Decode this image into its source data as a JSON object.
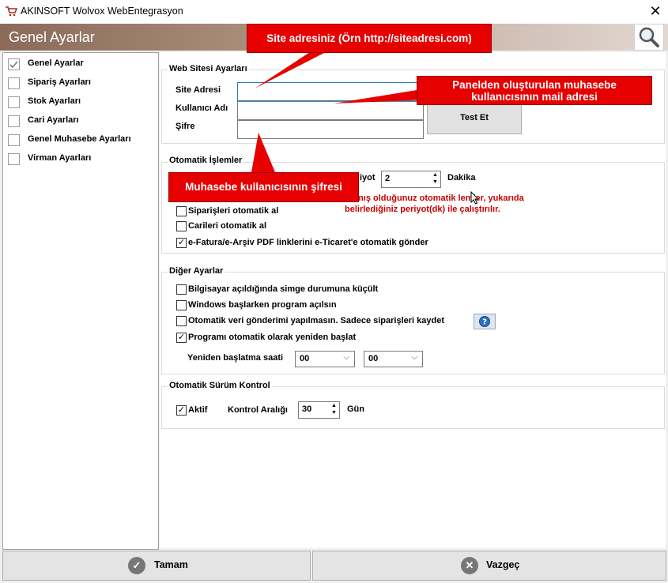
{
  "window": {
    "title": "AKINSOFT Wolvox WebEntegrasyon",
    "close_glyph": "✕"
  },
  "header": {
    "title": "Genel Ayarlar"
  },
  "sidebar": {
    "items": [
      {
        "label": "Genel Ayarlar",
        "checked": true
      },
      {
        "label": "Sipariş Ayarları",
        "checked": false
      },
      {
        "label": "Stok Ayarları",
        "checked": false
      },
      {
        "label": "Cari Ayarları",
        "checked": false
      },
      {
        "label": "Genel Muhasebe Ayarları",
        "checked": false
      },
      {
        "label": "Virman Ayarları",
        "checked": false
      }
    ]
  },
  "website": {
    "group_label": "Web Sitesi Ayarları",
    "site_label": "Site Adresi",
    "site_value": "",
    "user_label": "Kullanıcı Adı",
    "user_value": "",
    "pass_label": "Şifre",
    "pass_value": "",
    "test_button": "Test Et"
  },
  "auto": {
    "group_label": "Otomatik İşlemler",
    "period_label_fragment": "iyot",
    "period_value": "2",
    "period_unit": "Dakika",
    "info_line1": "mış olduğunuz otomatik  lemler, yukarıda",
    "info_line2": "belirlediğiniz periyot(dk) ile çalıştırılır.",
    "options": [
      {
        "label": "Siparişleri otomatik al",
        "checked": false
      },
      {
        "label": "Carileri otomatik al",
        "checked": false
      },
      {
        "label": "e-Fatura/e-Arşiv PDF linklerini e-Ticaret'e otomatik gönder",
        "checked": true
      }
    ]
  },
  "other": {
    "group_label": "Diğer Ayarlar",
    "options": [
      {
        "label": "Bilgisayar açıldığında simge durumuna küçült",
        "checked": false
      },
      {
        "label": "Windows başlarken program açılsın",
        "checked": false
      },
      {
        "label": "Otomatik veri gönderimi yapılmasın. Sadece siparişleri kaydet",
        "checked": false
      },
      {
        "label": "Programı otomatik olarak yeniden başlat",
        "checked": true
      }
    ],
    "help_icon": "help-icon",
    "restart_label": "Yeniden başlatma saati",
    "restart_hour": "00",
    "restart_minute": "00"
  },
  "version": {
    "group_label": "Otomatik Sürüm Kontrol",
    "active_label": "Aktif",
    "active_checked": true,
    "interval_label": "Kontrol Aralığı",
    "interval_value": "30",
    "interval_unit": "Gün"
  },
  "callouts": {
    "site": "Site adresiniz (Örn http://siteadresi.com)",
    "mail": "Panelden oluşturulan muhasebe kullanıcısının mail adresi",
    "pass": "Muhasebe kullanıcısının şifresi"
  },
  "footer": {
    "ok_label": "Tamam",
    "cancel_label": "Vazgeç"
  },
  "colors": {
    "header_gradient_start": "#8a6a58",
    "callout_red": "#e60000",
    "info_red": "#cc0000"
  }
}
